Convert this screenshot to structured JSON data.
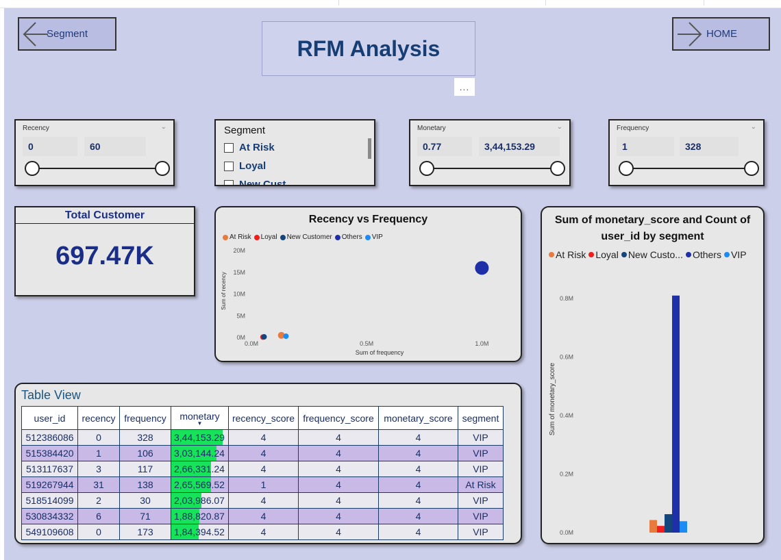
{
  "nav": {
    "back_label": "Segment",
    "home_label": "HOME"
  },
  "title": "RFM Analysis",
  "more_label": "...",
  "slicers": {
    "recency": {
      "label": "Recency",
      "min": "0",
      "max": "60"
    },
    "monetary": {
      "label": "Monetary",
      "min": "0.77",
      "max": "3,44,153.29"
    },
    "frequency": {
      "label": "Frequency",
      "min": "1",
      "max": "328"
    }
  },
  "segment_slicer": {
    "header": "Segment",
    "items": [
      "At Risk",
      "Loyal",
      "New Cust..."
    ]
  },
  "kpi": {
    "title": "Total Customer",
    "value": "697.47K"
  },
  "colors": {
    "at_risk": "#e97a3e",
    "loyal": "#f21c1c",
    "new_customer": "#12467c",
    "others": "#1f2fa8",
    "vip": "#1c8cf4",
    "mon_bar": "#17e35a"
  },
  "chart_data": [
    {
      "type": "scatter",
      "title": "Recency vs Frequency",
      "xlabel": "Sum of frequency",
      "ylabel": "Sum of recency",
      "x_ticks": [
        "0.0M",
        "0.5M",
        "1.0M"
      ],
      "y_ticks": [
        "0M",
        "5M",
        "10M",
        "15M",
        "20M"
      ],
      "xlim": [
        0,
        1100000
      ],
      "ylim": [
        0,
        20000000
      ],
      "legend_position": "top-left",
      "series": [
        {
          "name": "At Risk",
          "color": "#e97a3e",
          "x": 130000,
          "y": 500000
        },
        {
          "name": "Loyal",
          "color": "#f21c1c",
          "x": 50000,
          "y": 100000
        },
        {
          "name": "New Customer",
          "color": "#12467c",
          "x": 55000,
          "y": 150000
        },
        {
          "name": "Others",
          "color": "#1f2fa8",
          "x": 1000000,
          "y": 16000000
        },
        {
          "name": "VIP",
          "color": "#1c8cf4",
          "x": 150000,
          "y": 300000
        }
      ]
    },
    {
      "type": "bar",
      "title_lines": [
        "Sum of monetary_score and Count of",
        "user_id by segment"
      ],
      "ylabel": "Sum of monetary_score",
      "y_ticks": [
        "0.0M",
        "0.2M",
        "0.4M",
        "0.6M",
        "0.8M"
      ],
      "ylim": [
        0,
        0.8
      ],
      "legend_position": "top",
      "legend": [
        "At Risk",
        "Loyal",
        "New Custo...",
        "Others",
        "VIP"
      ],
      "categories": [
        "At Risk",
        "Loyal",
        "New Customer",
        "Others",
        "VIP"
      ],
      "values": [
        0.043,
        0.023,
        0.063,
        0.81,
        0.039
      ],
      "colors": [
        "#e97a3e",
        "#f21c1c",
        "#12467c",
        "#1f2fa8",
        "#1c8cf4"
      ]
    }
  ],
  "table": {
    "title": "Table View",
    "columns": [
      "user_id",
      "recency",
      "frequency",
      "monetary",
      "recency_score",
      "frequency_score",
      "monetary_score",
      "segment"
    ],
    "rows": [
      [
        "512386086",
        "0",
        "328",
        "3,44,153.29",
        "4",
        "4",
        "4",
        "VIP"
      ],
      [
        "515384420",
        "1",
        "106",
        "3,03,144.24",
        "4",
        "4",
        "4",
        "VIP"
      ],
      [
        "513117637",
        "3",
        "117",
        "2,66,331.24",
        "4",
        "4",
        "4",
        "VIP"
      ],
      [
        "519267944",
        "31",
        "138",
        "2,65,569.52",
        "1",
        "4",
        "4",
        "At Risk"
      ],
      [
        "518514099",
        "2",
        "30",
        "2,03,986.07",
        "4",
        "4",
        "4",
        "VIP"
      ],
      [
        "530834332",
        "6",
        "71",
        "1,88,820.87",
        "4",
        "4",
        "4",
        "VIP"
      ],
      [
        "549109608",
        "0",
        "173",
        "1,84,394.52",
        "4",
        "4",
        "4",
        "VIP"
      ]
    ],
    "monetary_fill": [
      1.0,
      0.881,
      0.774,
      0.772,
      0.593,
      0.549,
      0.536
    ]
  }
}
